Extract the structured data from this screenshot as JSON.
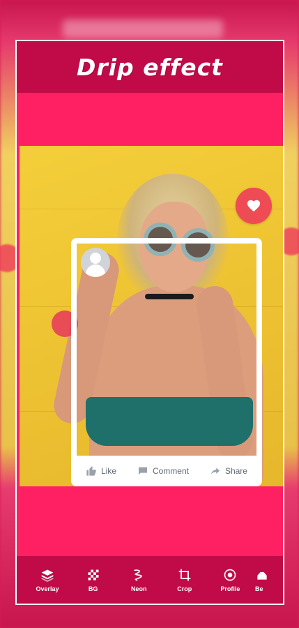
{
  "app": {
    "title": "Drip effect"
  },
  "card": {
    "actions": [
      {
        "label": "Like",
        "icon": "thumbs-up-icon"
      },
      {
        "label": "Comment",
        "icon": "comment-icon"
      },
      {
        "label": "Share",
        "icon": "share-icon"
      }
    ],
    "reaction_icon": "heart-icon"
  },
  "toolbar": {
    "items": [
      {
        "label": "Overlay",
        "icon": "layers-icon"
      },
      {
        "label": "BG",
        "icon": "checker-icon"
      },
      {
        "label": "Neon",
        "icon": "neon-scribble-icon"
      },
      {
        "label": "Crop",
        "icon": "crop-icon"
      },
      {
        "label": "Profile",
        "icon": "profile-target-icon"
      },
      {
        "label": "Be",
        "icon": "partial-icon"
      }
    ]
  },
  "colors": {
    "primary": "#c10a48",
    "accent": "#ff1f63",
    "heart": "#ee4b55"
  }
}
